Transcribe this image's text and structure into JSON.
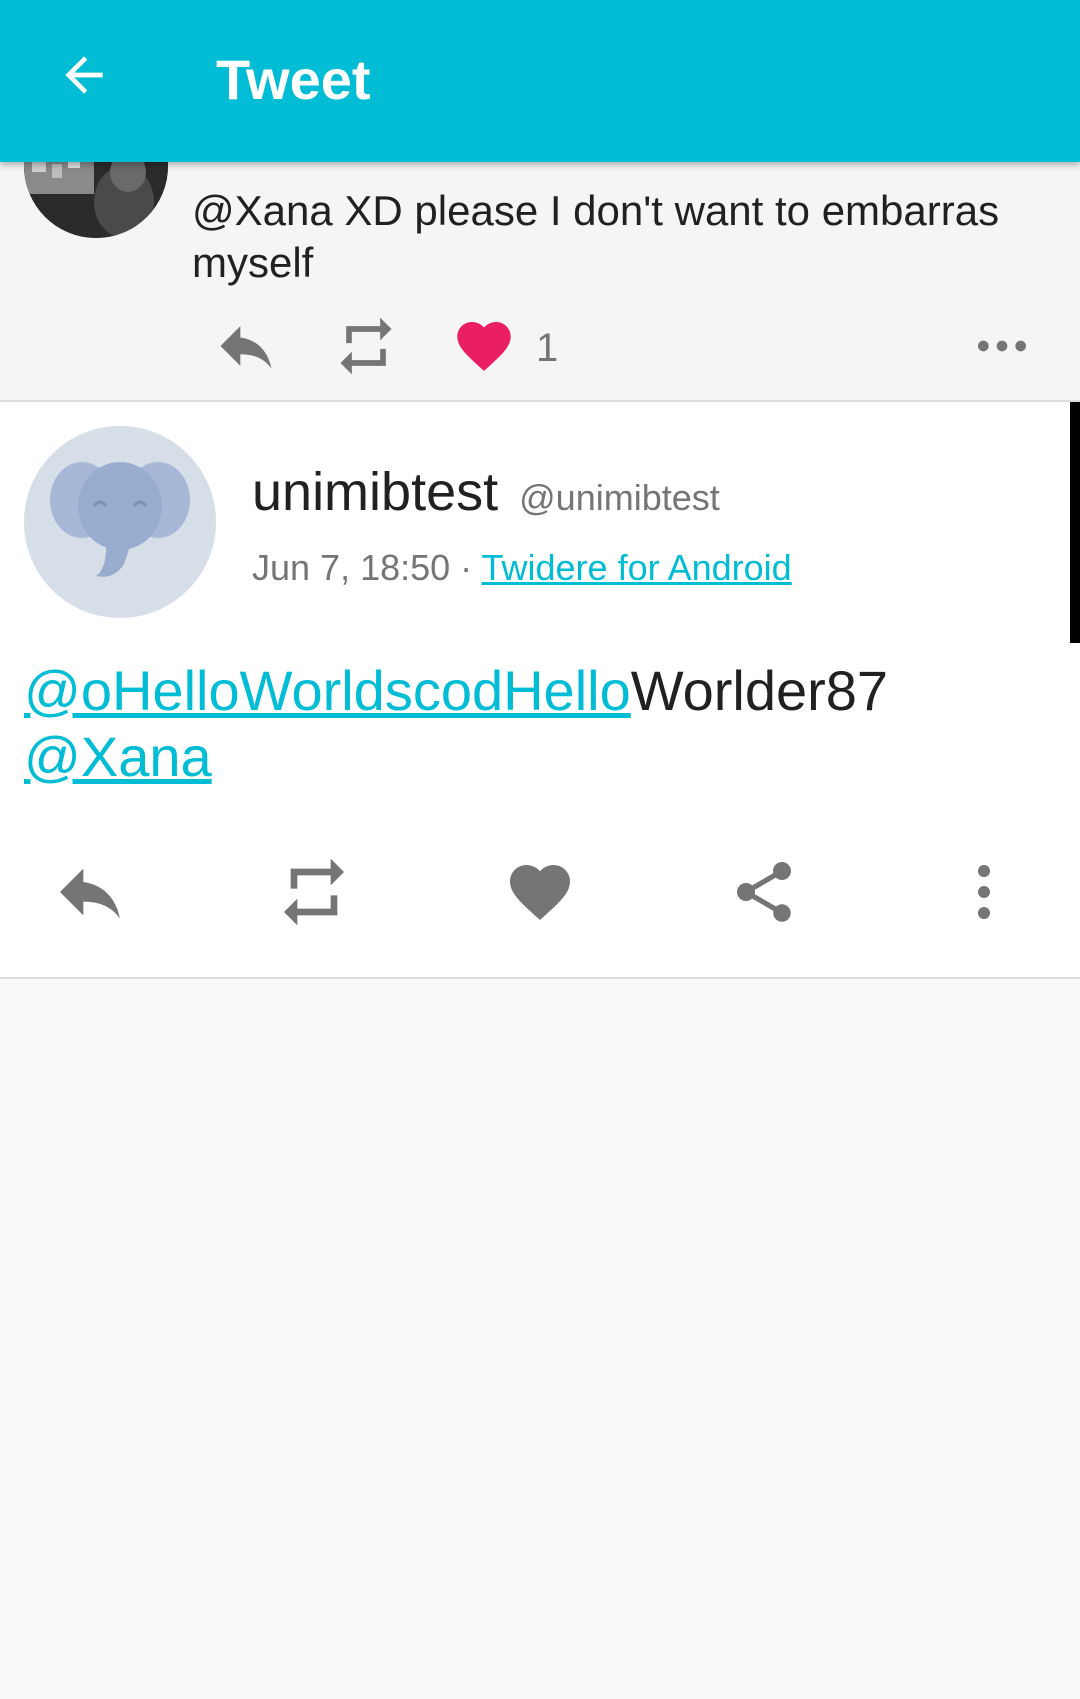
{
  "appbar": {
    "title": "Tweet",
    "back_icon": "arrow-back-icon",
    "background_color": "#00bcd4"
  },
  "previous_tweet": {
    "text": "@Xana XD please I don't want to embarras myself",
    "like_count": "1",
    "like_color": "#e91e63",
    "icons": [
      "reply-icon",
      "retweet-icon",
      "heart-icon",
      "more-horizontal-icon"
    ]
  },
  "tweet": {
    "user_name": "unimibtest",
    "screen_name": "@unimibtest",
    "time": "Jun 7, 18:50",
    "separator": " · ",
    "source": "Twidere for Android",
    "mention1": "@oHelloWorldscodHello",
    "text_rest": "Worlder87",
    "mention2": "@Xana",
    "link_color": "#00bcd4",
    "actions": [
      "reply-icon",
      "retweet-icon",
      "heart-icon",
      "share-icon",
      "more-vertical-icon"
    ]
  }
}
